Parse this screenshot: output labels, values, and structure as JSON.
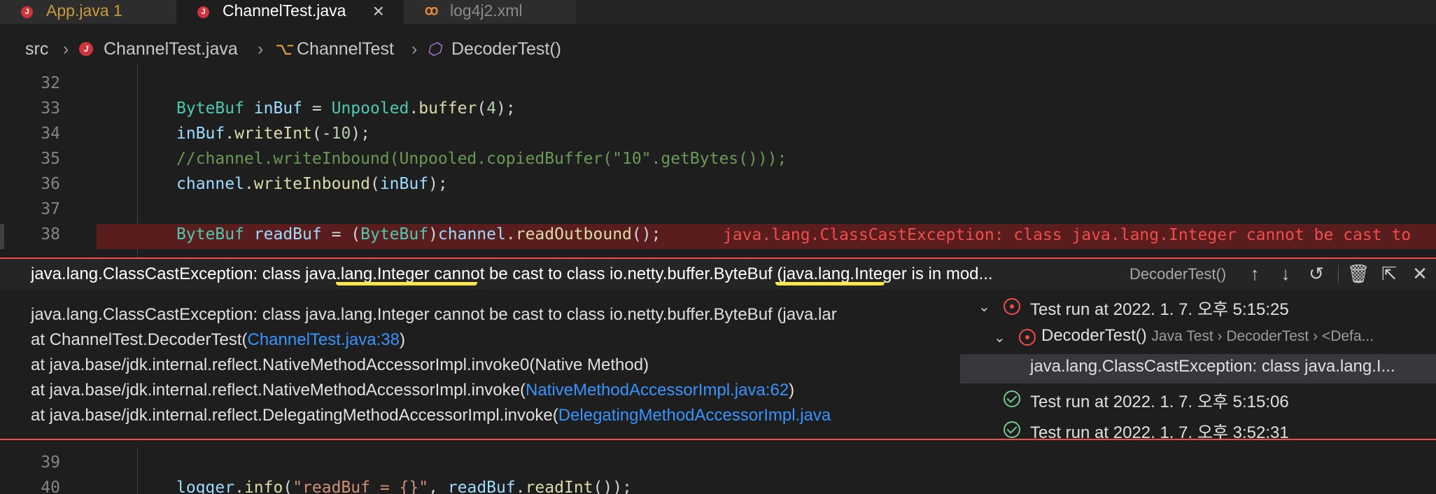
{
  "tabs": [
    {
      "label": "App.java 1",
      "icon": "java-file-icon"
    },
    {
      "label": "ChannelTest.java",
      "icon": "java-file-icon",
      "active": true
    },
    {
      "label": "log4j2.xml",
      "icon": "xml-file-icon"
    }
  ],
  "breadcrumb": {
    "root": "src",
    "file": "ChannelTest.java",
    "class": "ChannelTest",
    "method": "DecoderTest()"
  },
  "editor": {
    "line_numbers": [
      "32",
      "33",
      "34",
      "35",
      "36",
      "37",
      "38",
      "39",
      "40"
    ],
    "inline_error": "java.lang.ClassCastException: class java.lang.Integer cannot be cast to"
  },
  "peek": {
    "title": "java.lang.ClassCastException: class java.lang.Integer cannot be cast to class io.netty.buffer.ByteBuf (java.lang.Integer is in mod...",
    "subtitle": "DecoderTest()",
    "stack": [
      {
        "text": "java.lang.ClassCastException: class java.lang.Integer cannot be cast to class io.netty.buffer.ByteBuf (java.lar",
        "link": ""
      },
      {
        "text": " at ChannelTest.DecoderTest(",
        "link": "ChannelTest.java:38",
        "tail": ")"
      },
      {
        "text": " at java.base/jdk.internal.reflect.NativeMethodAccessorImpl.invoke0(Native Method)",
        "link": ""
      },
      {
        "text": " at java.base/jdk.internal.reflect.NativeMethodAccessorImpl.invoke(",
        "link": "NativeMethodAccessorImpl.java:62",
        "tail": ")"
      },
      {
        "text": " at java.base/jdk.internal.reflect.DelegatingMethodAccessorImpl.invoke(",
        "link": "DelegatingMethodAccessorImpl.java",
        "tail": ""
      }
    ],
    "tree": [
      {
        "label": "Test run at 2022. 1. 7. 오후 5:15:25",
        "status": "error"
      },
      {
        "label": "DecoderTest()",
        "detail": "Java Test › DecoderTest › <Defa...",
        "status": "error"
      },
      {
        "label": "java.lang.ClassCastException: class java.lang.I...",
        "selected": true
      },
      {
        "label": "Test run at 2022. 1. 7. 오후 5:15:06",
        "status": "passed"
      },
      {
        "label": "Test run at 2022. 1. 7. 오후 3:52:31",
        "status": "passed"
      }
    ]
  },
  "colors": {
    "error": "#f14c4c",
    "link": "#3794ff",
    "highlight": "#ffe94a",
    "passed": "#73c991"
  }
}
